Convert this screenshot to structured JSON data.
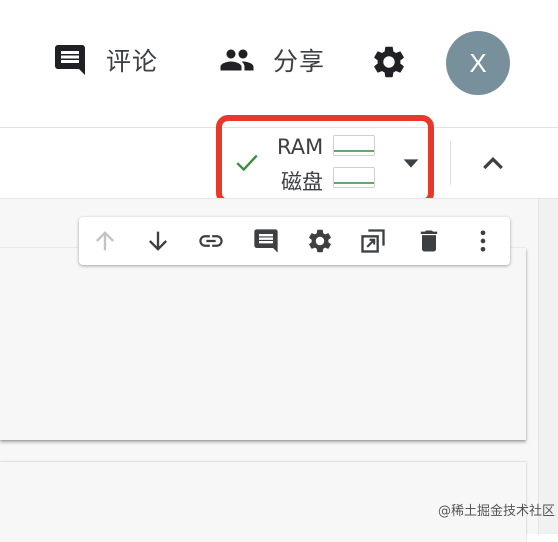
{
  "header": {
    "comment_label": "评论",
    "share_label": "分享",
    "avatar_initial": "X"
  },
  "runtime": {
    "ram_label": "RAM",
    "disk_label": "磁盘",
    "ram_usage_fraction": 0.0,
    "disk_usage_fraction": 0.0,
    "connected_status": "connected",
    "highlight_color": "#e8382b",
    "check_color": "#3d8b40"
  },
  "cell_toolbar": {
    "icons": [
      "arrow-up-icon",
      "arrow-down-icon",
      "link-icon",
      "comment-icon",
      "gear-icon",
      "mirror-cell-icon",
      "delete-icon",
      "more-vert-icon"
    ]
  },
  "watermark": {
    "text": "@稀土掘金技术社区"
  }
}
